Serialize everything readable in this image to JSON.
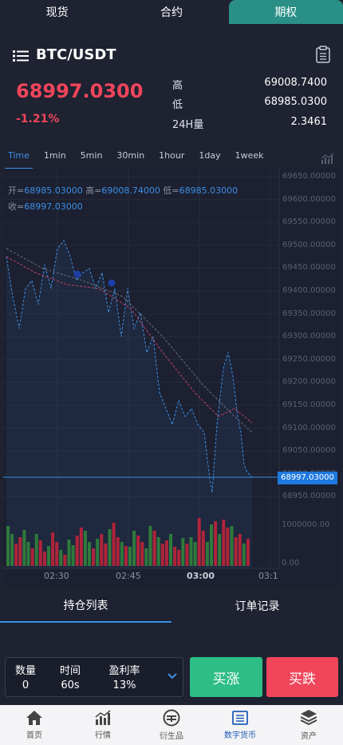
{
  "top_tabs": [
    "现货",
    "合约",
    "期权"
  ],
  "pair": "BTC/USDT",
  "price": "68997.0300",
  "change": "-1.21%",
  "stats": [
    {
      "label": "高",
      "value": "69008.7400"
    },
    {
      "label": "低",
      "value": "68985.0300"
    },
    {
      "label": "24H量",
      "value": "2.3461"
    }
  ],
  "intervals": [
    "Time",
    "1min",
    "5min",
    "30min",
    "1hour",
    "1day",
    "1week"
  ],
  "ohlc": {
    "open_label": "开=",
    "open": "68985.03000",
    "high_label": "高=",
    "high": "69008.74000",
    "low_label": "低=",
    "low": "68985.03000",
    "close_label": "收=",
    "close": "68997.03000"
  },
  "y_axis": [
    "69650.00000",
    "69600.00000",
    "69550.00000",
    "69500.00000",
    "69450.00000",
    "69400.00000",
    "69350.00000",
    "69300.00000",
    "69250.00000",
    "69200.00000",
    "69150.00000",
    "69100.00000",
    "69050.00000",
    "69000.00000",
    "68950.00000"
  ],
  "current_price_tag": "68997.03000",
  "vol_axis": [
    "1000000.00",
    "0.00"
  ],
  "x_axis": [
    "02:30",
    "02:45",
    "03:00",
    "03:1"
  ],
  "bottom_tabs": [
    "持仓列表",
    "订单记录"
  ],
  "trade": {
    "qty_label": "数量",
    "qty": "0",
    "time_label": "时间",
    "time": "60s",
    "profit_label": "盈利率",
    "profit": "13%"
  },
  "buy_up": "买涨",
  "buy_down": "买跌",
  "nav": [
    "首页",
    "行情",
    "衍生品",
    "数字货币",
    "资产"
  ],
  "colors": {
    "up": "#2dbd86",
    "down": "#f0455b",
    "accent": "#3b8fe6",
    "active_tab": "#2a8f86"
  }
}
